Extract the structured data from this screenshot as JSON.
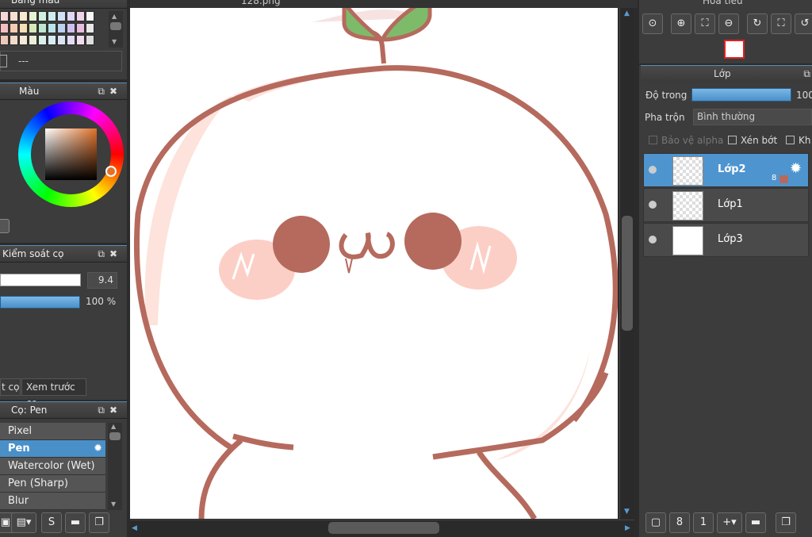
{
  "canvas": {
    "tab_title": "128.png"
  },
  "palette": {
    "title": "Bảng màu",
    "name_value": "---",
    "swatches": [
      "#f6d6d6",
      "#f6e0d0",
      "#fae8cf",
      "#e6f2d2",
      "#d2f0e0",
      "#d0ecf0",
      "#d2e0f6",
      "#e0d6f6",
      "#f0d4ea",
      "#f6f6f6",
      "#f2c0c0",
      "#f4ccb0",
      "#f8deb4",
      "#d6eab8",
      "#bce6cf",
      "#bce2ea",
      "#bcd0f0",
      "#d0c0f0",
      "#e8bede",
      "#e8e8e8",
      "#eec8b8",
      "#f2dcc8",
      "#f6ead8",
      "#e8f0d8",
      "#d8f0e8",
      "#d8ecf4",
      "#dce4f4",
      "#e4dcf4",
      "#f0dcec",
      "#dedede"
    ]
  },
  "color": {
    "title": "Màu",
    "accent": "#e0722a"
  },
  "brush_control": {
    "title": "Kiểm soát cọ",
    "size_value": "9.4",
    "opacity_value": "100 %"
  },
  "brush_tabs": {
    "tab1": "t cọ",
    "tab2": "Xem trước cọ"
  },
  "brush_list": {
    "title": "Cọ: Pen",
    "items": [
      "Pixel",
      "Pen",
      "Watercolor (Wet)",
      "Pen (Sharp)",
      "Blur"
    ],
    "selected": "Pen"
  },
  "navigator": {
    "title": "Hoa tiêu"
  },
  "layers": {
    "title": "Lớp",
    "opacity_label": "Độ trong",
    "opacity_value": "100",
    "blend_label": "Pha trộn",
    "blend_value": "Bình thường",
    "protect_alpha": "Bảo vệ alpha",
    "clip": "Xén bớt",
    "lock": "Kh",
    "items": [
      {
        "name": "Lớp2",
        "badge": "8",
        "selected": true
      },
      {
        "name": "Lớp1"
      },
      {
        "name": "Lớp3"
      }
    ]
  },
  "icons": [
    "gear-icon",
    "zoom-in-icon",
    "zoom-out-icon",
    "fit-icon",
    "rotate-icon",
    "folder-icon",
    "duplicate-icon",
    "new-layer-icon"
  ]
}
